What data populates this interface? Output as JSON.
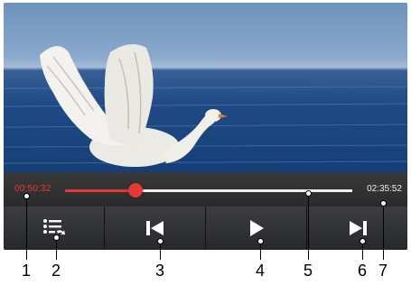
{
  "player": {
    "time_elapsed": "00:50:32",
    "time_total": "02:35:52",
    "progress_fraction": 0.245,
    "colors": {
      "accent": "#e53935",
      "track": "#f0f0f0",
      "bar": "#2b2b2b"
    }
  },
  "controls": [
    {
      "name": "playlist-button",
      "icon": "playlist-icon"
    },
    {
      "name": "previous-button",
      "icon": "skip-previous-icon"
    },
    {
      "name": "play-button",
      "icon": "play-icon"
    },
    {
      "name": "next-button",
      "icon": "skip-next-icon"
    }
  ],
  "callouts": [
    "1",
    "2",
    "3",
    "4",
    "5",
    "6",
    "7"
  ]
}
